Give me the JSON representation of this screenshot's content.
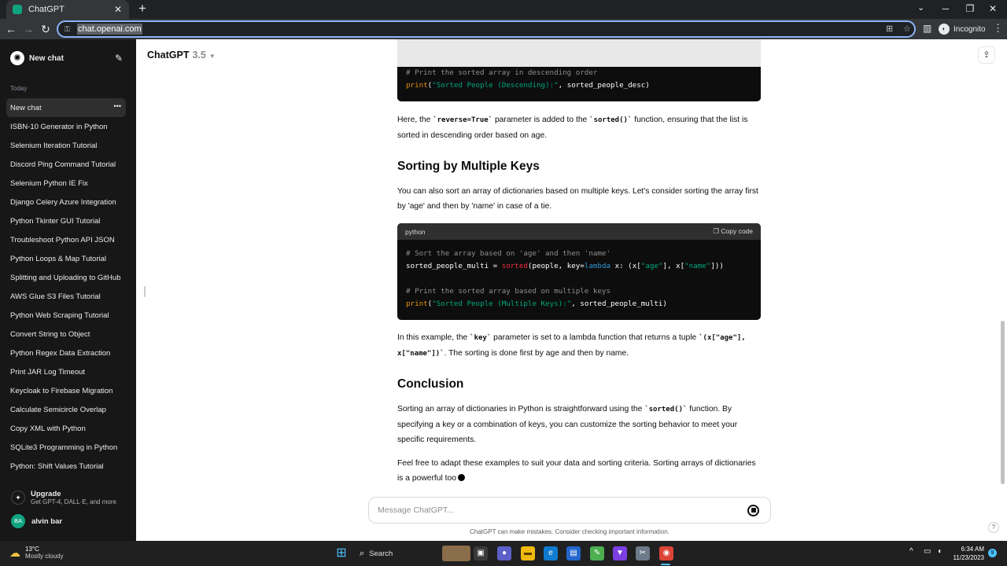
{
  "browser": {
    "tab_title": "ChatGPT",
    "tab_close": "✕",
    "new_tab": "+",
    "url": "chat.openai.com",
    "profile": "Incognito"
  },
  "sidebar": {
    "new_chat_label": "New chat",
    "group_label": "Today",
    "items": [
      {
        "label": "New chat",
        "active": true
      },
      {
        "label": "ISBN-10 Generator in Python"
      },
      {
        "label": "Selenium Iteration Tutorial"
      },
      {
        "label": "Discord Ping Command Tutorial"
      },
      {
        "label": "Selenium Python IE Fix"
      },
      {
        "label": "Django Celery Azure Integration"
      },
      {
        "label": "Python Tkinter GUI Tutorial"
      },
      {
        "label": "Troubleshoot Python API JSON"
      },
      {
        "label": "Python Loops & Map Tutorial"
      },
      {
        "label": "Splitting and Uploading to GitHub"
      },
      {
        "label": "AWS Glue S3 Files Tutorial"
      },
      {
        "label": "Python Web Scraping Tutorial"
      },
      {
        "label": "Convert String to Object"
      },
      {
        "label": "Python Regex Data Extraction"
      },
      {
        "label": "Print JAR Log Timeout"
      },
      {
        "label": "Keycloak to Firebase Migration"
      },
      {
        "label": "Calculate Semicircle Overlap"
      },
      {
        "label": "Copy XML with Python"
      },
      {
        "label": "SQLite3 Programming in Python"
      },
      {
        "label": "Python: Shift Values Tutorial"
      }
    ],
    "upgrade_title": "Upgrade",
    "upgrade_sub": "Get GPT-4, DALL·E, and more",
    "user_initials": "BA",
    "user_name": "alvin bar"
  },
  "header": {
    "model_name": "ChatGPT",
    "model_version": "3.5"
  },
  "content": {
    "para1_prefix": "Here, the ",
    "para1_code1": "`reverse=True`",
    "para1_mid": " parameter is added to the ",
    "para1_code2": "`sorted()`",
    "para1_suffix": " function, ensuring that the list is sorted in descending order based on age.",
    "heading1": "Sorting by Multiple Keys",
    "para2": "You can also sort an array of dictionaries based on multiple keys. Let's consider sorting the array first by 'age' and then by 'name' in case of a tie.",
    "code_lang": "python",
    "copy_label": "Copy code",
    "para3_prefix": "In this example, the ",
    "para3_code1": "`key`",
    "para3_mid": " parameter is set to a lambda function that returns a tuple ",
    "para3_code2": "`(x[\"age\"], x[\"name\"])`",
    "para3_suffix": ". The sorting is done first by age and then by name.",
    "heading2": "Conclusion",
    "para4_prefix": "Sorting an array of dictionaries in Python is straightforward using the ",
    "para4_code": "`sorted()`",
    "para4_suffix": " function. By specifying a key or a combination of keys, you can customize the sorting behavior to meet your specific requirements.",
    "para5": "Feel free to adapt these examples to suit your data and sorting criteria. Sorting arrays of dictionaries is a powerful too"
  },
  "code1": {
    "comment": "# Print the sorted array in descending order",
    "print_fn": "print",
    "open": "(",
    "string": "\"Sorted People (Descending):\"",
    "rest": ", sorted_people_desc)"
  },
  "code2": {
    "l1_comment": "# Sort the array based on 'age' and then 'name'",
    "l2_a": "sorted_people_multi = ",
    "l2_fn": "sorted",
    "l2_b": "(people, key=",
    "l2_kw": "lambda",
    "l2_c": " x: (x[",
    "l2_s1": "\"age\"",
    "l2_d": "], x[",
    "l2_s2": "\"name\"",
    "l2_e": "]))",
    "l4_comment": "# Print the sorted array based on multiple keys",
    "l5_fn": "print",
    "l5_open": "(",
    "l5_str": "\"Sorted People (Multiple Keys):\"",
    "l5_rest": ", sorted_people_multi)"
  },
  "composer": {
    "placeholder": "Message ChatGPT...",
    "disclaimer": "ChatGPT can make mistakes. Consider checking important information."
  },
  "taskbar": {
    "weather_temp": "13°C",
    "weather_desc": "Mostly cloudy",
    "search_label": "Search",
    "time": "6:34 AM",
    "date": "11/23/2023",
    "notification_count": "9"
  },
  "colors": {
    "sidebar_bg": "#171717",
    "accent": "#10a37f",
    "omnibox_focus": "#8ab4f8"
  }
}
